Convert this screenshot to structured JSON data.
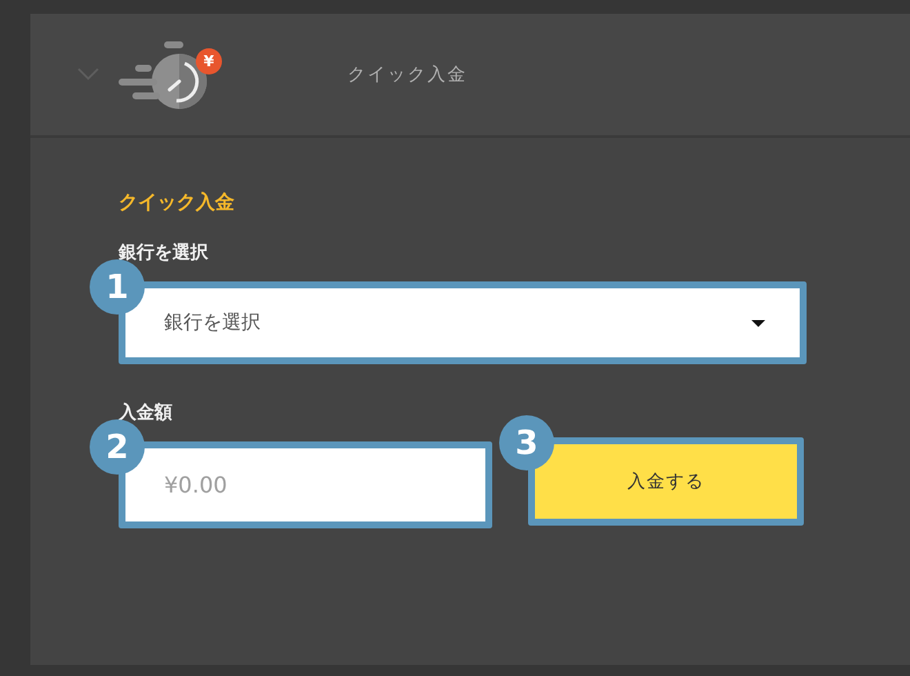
{
  "header": {
    "expanded": false,
    "icon_badge": "¥",
    "title": "クイック入金"
  },
  "form": {
    "title": "クイック入金",
    "bank_label": "銀行を選択",
    "bank_select": {
      "value": "銀行を選択",
      "marker": "1"
    },
    "amount_label": "入金額",
    "amount_field": {
      "placeholder": "¥0.00",
      "marker": "2"
    },
    "submit_button": {
      "label": "入金する",
      "marker": "3"
    }
  }
}
